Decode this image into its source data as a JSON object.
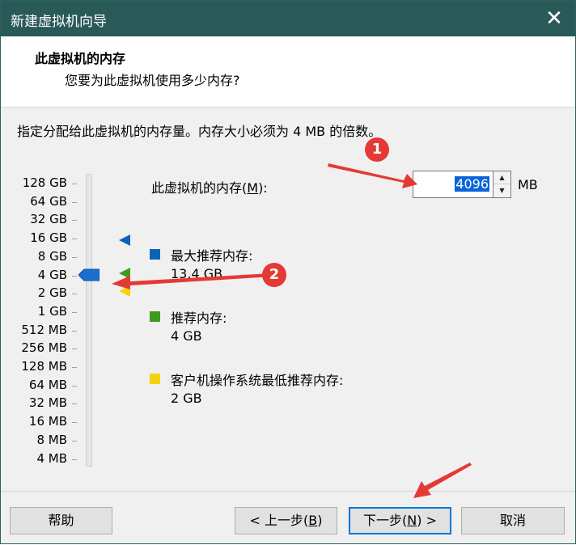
{
  "window": {
    "title": "新建虚拟机向导",
    "close_icon": "close-icon"
  },
  "header": {
    "title": "此虚拟机的内存",
    "subtitle": "您要为此虚拟机使用多少内存?"
  },
  "instruction": "指定分配给此虚拟机的内存量。内存大小必须为 4 MB 的倍数。",
  "scale": {
    "labels": [
      "128 GB",
      "64 GB",
      "32 GB",
      "16 GB",
      "8 GB",
      "4 GB",
      "2 GB",
      "1 GB",
      "512 MB",
      "256 MB",
      "128 MB",
      "64 MB",
      "32 MB",
      "16 MB",
      "8 MB",
      "4 MB"
    ]
  },
  "memory": {
    "label_prefix": "此虚拟机的内存(",
    "label_key": "M",
    "label_suffix": "):",
    "value": "4096",
    "unit": "MB"
  },
  "legend": {
    "max": {
      "label": "最大推荐内存:",
      "value": "13.4 GB",
      "color": "#0b63b6"
    },
    "recommended": {
      "label": "推荐内存:",
      "value": "4 GB",
      "color": "#3f9a1f"
    },
    "minimum": {
      "label": "客户机操作系统最低推荐内存:",
      "value": "2 GB",
      "color": "#f5d20c"
    }
  },
  "buttons": {
    "help": "帮助",
    "back_prefix": "< 上一步(",
    "back_key": "B",
    "back_suffix": ")",
    "next_prefix": "下一步(",
    "next_key": "N",
    "next_suffix": ") >",
    "cancel": "取消"
  },
  "annotations": {
    "badge1": "1",
    "badge2": "2",
    "color": "#e53935"
  },
  "colors": {
    "titlebar": "#2a5a58",
    "accent": "#0078d7",
    "selection": "#0a64d8"
  }
}
